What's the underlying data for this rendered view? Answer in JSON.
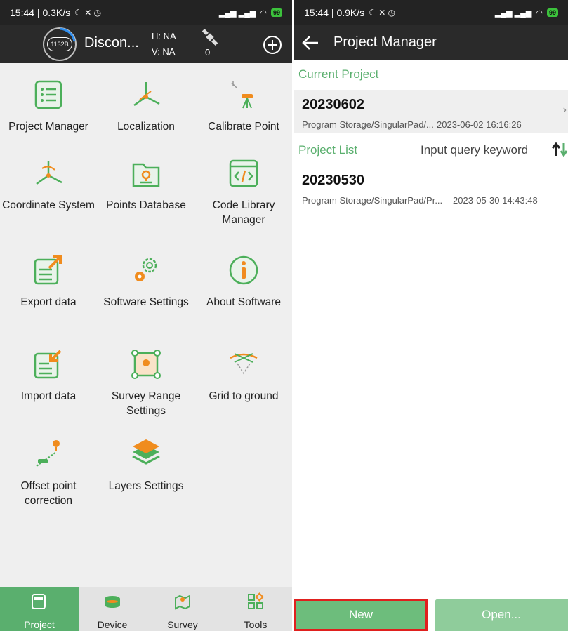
{
  "left_screen": {
    "status_bar": {
      "time_speed": "15:44 | 0.3K/s",
      "battery": "99"
    },
    "header": {
      "gauge_label": "1132B",
      "connection_status": "Discon...",
      "h_value": "H: NA",
      "v_value": "V: NA",
      "satellite_count": "0"
    },
    "tiles": [
      {
        "label": "Project Manager",
        "icon": "project-manager-icon"
      },
      {
        "label": "Localization",
        "icon": "localization-icon"
      },
      {
        "label": "Calibrate Point",
        "icon": "calibrate-point-icon"
      },
      {
        "label": "Coordinate System",
        "icon": "coordinate-system-icon"
      },
      {
        "label": "Points Database",
        "icon": "points-database-icon"
      },
      {
        "label": "Code Library Manager",
        "icon": "code-library-icon"
      },
      {
        "label": "Export data",
        "icon": "export-data-icon"
      },
      {
        "label": "Software Settings",
        "icon": "software-settings-icon"
      },
      {
        "label": "About Software",
        "icon": "about-software-icon"
      },
      {
        "label": "Import data",
        "icon": "import-data-icon"
      },
      {
        "label": "Survey Range Settings",
        "icon": "survey-range-icon"
      },
      {
        "label": "Grid to ground",
        "icon": "grid-to-ground-icon"
      },
      {
        "label": "Offset point correction",
        "icon": "offset-point-icon"
      },
      {
        "label": "Layers Settings",
        "icon": "layers-settings-icon"
      }
    ],
    "bottom_nav": [
      {
        "label": "Project",
        "active": true,
        "icon": "project-tab-icon"
      },
      {
        "label": "Device",
        "active": false,
        "icon": "device-tab-icon"
      },
      {
        "label": "Survey",
        "active": false,
        "icon": "survey-tab-icon"
      },
      {
        "label": "Tools",
        "active": false,
        "icon": "tools-tab-icon"
      }
    ]
  },
  "right_screen": {
    "status_bar": {
      "time_speed": "15:44 | 0.9K/s",
      "battery": "99"
    },
    "header": {
      "title": "Project Manager"
    },
    "current_project": {
      "section_label": "Current Project",
      "name": "20230602",
      "path": "Program Storage/SingularPad/...",
      "date": "2023-06-02 16:16:26"
    },
    "project_list": {
      "section_label": "Project List",
      "query_placeholder": "Input query keyword",
      "items": [
        {
          "name": "20230530",
          "path": "Program Storage/SingularPad/Pr...",
          "date": "2023-05-30 14:43:48"
        }
      ]
    },
    "buttons": {
      "new": "New",
      "open": "Open..."
    }
  },
  "colors": {
    "accent_green": "#5aaf6e",
    "header_dark": "#2a2a2a",
    "icon_green": "#4caf5a",
    "icon_orange": "#f08c1e",
    "highlight_red": "#e0201e"
  }
}
